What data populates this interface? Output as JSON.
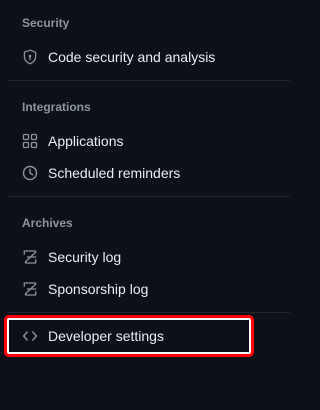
{
  "sections": {
    "security": {
      "title": "Security",
      "items": [
        {
          "label": "Code security and analysis",
          "icon": "shield-lock-icon"
        }
      ]
    },
    "integrations": {
      "title": "Integrations",
      "items": [
        {
          "label": "Applications",
          "icon": "apps-icon"
        },
        {
          "label": "Scheduled reminders",
          "icon": "clock-icon"
        }
      ]
    },
    "archives": {
      "title": "Archives",
      "items": [
        {
          "label": "Security log",
          "icon": "log-icon"
        },
        {
          "label": "Sponsorship log",
          "icon": "log-icon"
        }
      ]
    },
    "developer": {
      "items": [
        {
          "label": "Developer settings",
          "icon": "code-icon",
          "highlighted": true
        }
      ]
    }
  },
  "colors": {
    "background": "#0d1117",
    "text": "#e6edf3",
    "section_title": "#8b949e",
    "divider": "#21262d",
    "highlight_border": "#ff0000"
  }
}
